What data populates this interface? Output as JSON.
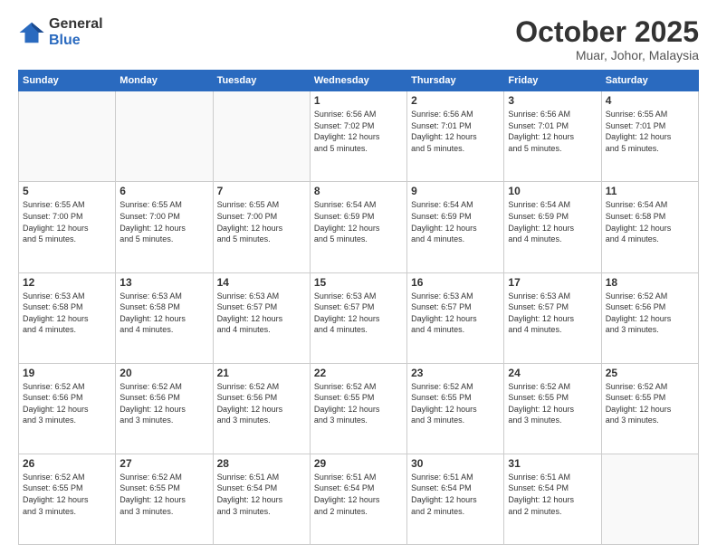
{
  "header": {
    "logo_general": "General",
    "logo_blue": "Blue",
    "month": "October 2025",
    "location": "Muar, Johor, Malaysia"
  },
  "days_of_week": [
    "Sunday",
    "Monday",
    "Tuesday",
    "Wednesday",
    "Thursday",
    "Friday",
    "Saturday"
  ],
  "weeks": [
    [
      {
        "day": "",
        "info": ""
      },
      {
        "day": "",
        "info": ""
      },
      {
        "day": "",
        "info": ""
      },
      {
        "day": "1",
        "info": "Sunrise: 6:56 AM\nSunset: 7:02 PM\nDaylight: 12 hours\nand 5 minutes."
      },
      {
        "day": "2",
        "info": "Sunrise: 6:56 AM\nSunset: 7:01 PM\nDaylight: 12 hours\nand 5 minutes."
      },
      {
        "day": "3",
        "info": "Sunrise: 6:56 AM\nSunset: 7:01 PM\nDaylight: 12 hours\nand 5 minutes."
      },
      {
        "day": "4",
        "info": "Sunrise: 6:55 AM\nSunset: 7:01 PM\nDaylight: 12 hours\nand 5 minutes."
      }
    ],
    [
      {
        "day": "5",
        "info": "Sunrise: 6:55 AM\nSunset: 7:00 PM\nDaylight: 12 hours\nand 5 minutes."
      },
      {
        "day": "6",
        "info": "Sunrise: 6:55 AM\nSunset: 7:00 PM\nDaylight: 12 hours\nand 5 minutes."
      },
      {
        "day": "7",
        "info": "Sunrise: 6:55 AM\nSunset: 7:00 PM\nDaylight: 12 hours\nand 5 minutes."
      },
      {
        "day": "8",
        "info": "Sunrise: 6:54 AM\nSunset: 6:59 PM\nDaylight: 12 hours\nand 5 minutes."
      },
      {
        "day": "9",
        "info": "Sunrise: 6:54 AM\nSunset: 6:59 PM\nDaylight: 12 hours\nand 4 minutes."
      },
      {
        "day": "10",
        "info": "Sunrise: 6:54 AM\nSunset: 6:59 PM\nDaylight: 12 hours\nand 4 minutes."
      },
      {
        "day": "11",
        "info": "Sunrise: 6:54 AM\nSunset: 6:58 PM\nDaylight: 12 hours\nand 4 minutes."
      }
    ],
    [
      {
        "day": "12",
        "info": "Sunrise: 6:53 AM\nSunset: 6:58 PM\nDaylight: 12 hours\nand 4 minutes."
      },
      {
        "day": "13",
        "info": "Sunrise: 6:53 AM\nSunset: 6:58 PM\nDaylight: 12 hours\nand 4 minutes."
      },
      {
        "day": "14",
        "info": "Sunrise: 6:53 AM\nSunset: 6:57 PM\nDaylight: 12 hours\nand 4 minutes."
      },
      {
        "day": "15",
        "info": "Sunrise: 6:53 AM\nSunset: 6:57 PM\nDaylight: 12 hours\nand 4 minutes."
      },
      {
        "day": "16",
        "info": "Sunrise: 6:53 AM\nSunset: 6:57 PM\nDaylight: 12 hours\nand 4 minutes."
      },
      {
        "day": "17",
        "info": "Sunrise: 6:53 AM\nSunset: 6:57 PM\nDaylight: 12 hours\nand 4 minutes."
      },
      {
        "day": "18",
        "info": "Sunrise: 6:52 AM\nSunset: 6:56 PM\nDaylight: 12 hours\nand 3 minutes."
      }
    ],
    [
      {
        "day": "19",
        "info": "Sunrise: 6:52 AM\nSunset: 6:56 PM\nDaylight: 12 hours\nand 3 minutes."
      },
      {
        "day": "20",
        "info": "Sunrise: 6:52 AM\nSunset: 6:56 PM\nDaylight: 12 hours\nand 3 minutes."
      },
      {
        "day": "21",
        "info": "Sunrise: 6:52 AM\nSunset: 6:56 PM\nDaylight: 12 hours\nand 3 minutes."
      },
      {
        "day": "22",
        "info": "Sunrise: 6:52 AM\nSunset: 6:55 PM\nDaylight: 12 hours\nand 3 minutes."
      },
      {
        "day": "23",
        "info": "Sunrise: 6:52 AM\nSunset: 6:55 PM\nDaylight: 12 hours\nand 3 minutes."
      },
      {
        "day": "24",
        "info": "Sunrise: 6:52 AM\nSunset: 6:55 PM\nDaylight: 12 hours\nand 3 minutes."
      },
      {
        "day": "25",
        "info": "Sunrise: 6:52 AM\nSunset: 6:55 PM\nDaylight: 12 hours\nand 3 minutes."
      }
    ],
    [
      {
        "day": "26",
        "info": "Sunrise: 6:52 AM\nSunset: 6:55 PM\nDaylight: 12 hours\nand 3 minutes."
      },
      {
        "day": "27",
        "info": "Sunrise: 6:52 AM\nSunset: 6:55 PM\nDaylight: 12 hours\nand 3 minutes."
      },
      {
        "day": "28",
        "info": "Sunrise: 6:51 AM\nSunset: 6:54 PM\nDaylight: 12 hours\nand 3 minutes."
      },
      {
        "day": "29",
        "info": "Sunrise: 6:51 AM\nSunset: 6:54 PM\nDaylight: 12 hours\nand 2 minutes."
      },
      {
        "day": "30",
        "info": "Sunrise: 6:51 AM\nSunset: 6:54 PM\nDaylight: 12 hours\nand 2 minutes."
      },
      {
        "day": "31",
        "info": "Sunrise: 6:51 AM\nSunset: 6:54 PM\nDaylight: 12 hours\nand 2 minutes."
      },
      {
        "day": "",
        "info": ""
      }
    ]
  ]
}
